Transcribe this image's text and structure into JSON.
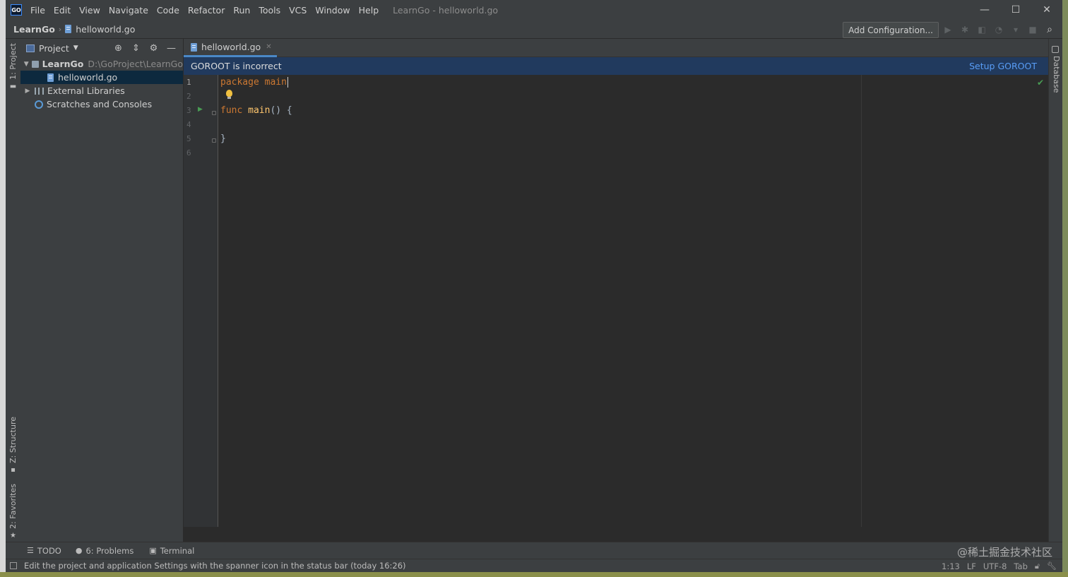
{
  "app": {
    "logo_text": "GO",
    "window_title": "LearnGo - helloworld.go",
    "menu": [
      "File",
      "Edit",
      "View",
      "Navigate",
      "Code",
      "Refactor",
      "Run",
      "Tools",
      "VCS",
      "Window",
      "Help"
    ],
    "window_controls": {
      "minimize": "—",
      "maximize": "☐",
      "close": "✕"
    }
  },
  "navbar": {
    "project": "LearnGo",
    "separator": "›",
    "file": "helloworld.go",
    "add_config_label": "Add Configuration...",
    "toolbar_icons": [
      "run-icon",
      "debug-icon",
      "coverage-icon",
      "profile-icon",
      "dropdown-icon",
      "stop-icon",
      "search-icon"
    ]
  },
  "left_strip": {
    "project_tab": "1: Project",
    "structure_tab": "Z: Structure",
    "favorites_tab": "2: Favorites"
  },
  "project_panel": {
    "title": "Project",
    "tree": [
      {
        "name": "LearnGo",
        "path": "D:\\GoProject\\LearnGo"
      },
      {
        "name": "helloworld.go"
      },
      {
        "name": "External Libraries"
      },
      {
        "name": "Scratches and Consoles"
      }
    ]
  },
  "editor": {
    "tab_label": "helloworld.go",
    "notification": {
      "text": "GOROOT is incorrect",
      "action": "Setup GOROOT"
    },
    "line_numbers": [
      "1",
      "2",
      "3",
      "4",
      "5",
      "6"
    ],
    "code": {
      "line1_kw": "package",
      "line1_name": "main",
      "line3_kw": "func",
      "line3_fn": "main",
      "line3_rest": "() {",
      "line5": "}"
    }
  },
  "right_strip": {
    "database_tab": "Database"
  },
  "bottom_tabs": {
    "todo": "TODO",
    "problems": "6: Problems",
    "terminal": "Terminal"
  },
  "watermark": "@稀土掘金技术社区",
  "statusbar": {
    "message": "Edit the project and application Settings with the spanner icon in the status bar (today 16:26)",
    "position": "1:13",
    "line_sep": "LF",
    "encoding": "UTF-8",
    "indent": "Tab"
  },
  "colors": {
    "background": "#2b2b2b",
    "panel": "#3c3f41",
    "notification_bg": "#213a5e",
    "link": "#589df6",
    "keyword": "#cc7832",
    "function": "#ffc66d",
    "selection": "#0d293e"
  }
}
